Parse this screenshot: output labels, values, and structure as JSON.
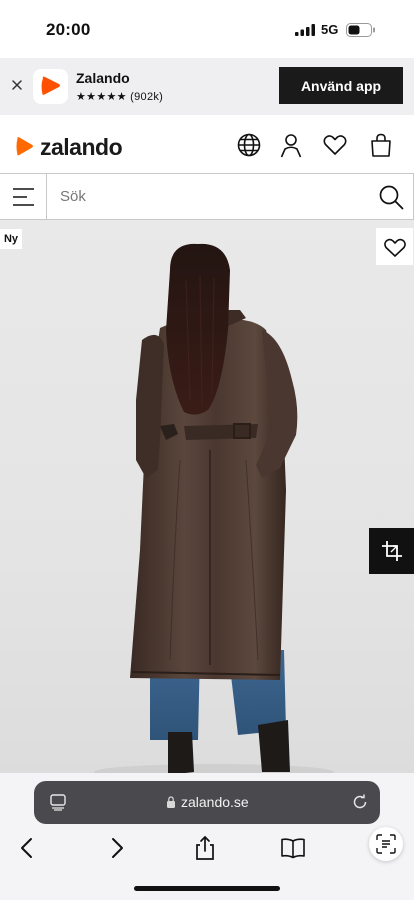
{
  "status_bar": {
    "time": "20:00",
    "network": "5G",
    "icons": [
      "moon-icon",
      "signal-icon",
      "battery-icon"
    ]
  },
  "app_banner": {
    "app_name": "Zalando",
    "rating": "★★★★★ (902k)",
    "cta_label": "Använd app",
    "icons": [
      "close-icon",
      "zalando-app-icon"
    ]
  },
  "header": {
    "logo_text": "zalando",
    "brand_color": "#ff6900",
    "icons": [
      "globe-icon",
      "user-icon",
      "heart-icon",
      "bag-icon"
    ]
  },
  "search": {
    "placeholder": "Sök",
    "value": "",
    "icons": [
      "menu-icon",
      "search-icon"
    ]
  },
  "product": {
    "badge": "Ny",
    "icons": [
      "wishlist-heart-icon",
      "crop-icon"
    ]
  },
  "browser": {
    "url": "zalando.se",
    "icons": [
      "tabs-icon",
      "lock-icon",
      "reload-icon",
      "back-icon",
      "forward-icon",
      "share-icon",
      "bookmarks-icon",
      "text-scan-icon"
    ]
  }
}
